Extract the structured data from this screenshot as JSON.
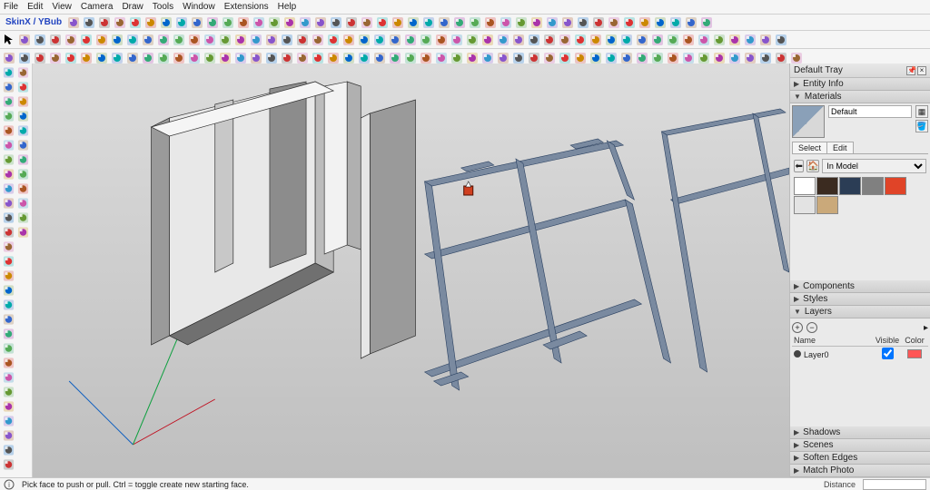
{
  "menubar": [
    "File",
    "Edit",
    "View",
    "Camera",
    "Draw",
    "Tools",
    "Window",
    "Extensions",
    "Help"
  ],
  "plugin_label": "SkinX / YBub",
  "right_panel": {
    "title": "Default Tray",
    "sections": {
      "entity_info": "Entity Info",
      "materials": "Materials",
      "components": "Components",
      "styles": "Styles",
      "layers": "Layers",
      "shadows": "Shadows",
      "scenes": "Scenes",
      "soften": "Soften Edges",
      "match": "Match Photo"
    },
    "material_name": "Default",
    "material_tabs": {
      "select": "Select",
      "edit": "Edit"
    },
    "material_library": "In Model",
    "swatches": [
      "#ffffff",
      "#3b2b20",
      "#2b3d55",
      "#808080",
      "#e04428",
      "#e3e3e3",
      "#caa97a"
    ],
    "layers": {
      "hdr_name": "Name",
      "hdr_visible": "Visible",
      "hdr_color": "Color",
      "rows": [
        {
          "name": "Layer0",
          "visible": true,
          "color": "#ff6a5a"
        }
      ]
    }
  },
  "statusbar": {
    "hint": "Pick face to push or pull. Ctrl = toggle create new starting face.",
    "distance_label": "Distance"
  },
  "toolbar_icons": {
    "row0_count": 42,
    "row1_count": 50,
    "row2_count": 52,
    "left_count": 40
  }
}
